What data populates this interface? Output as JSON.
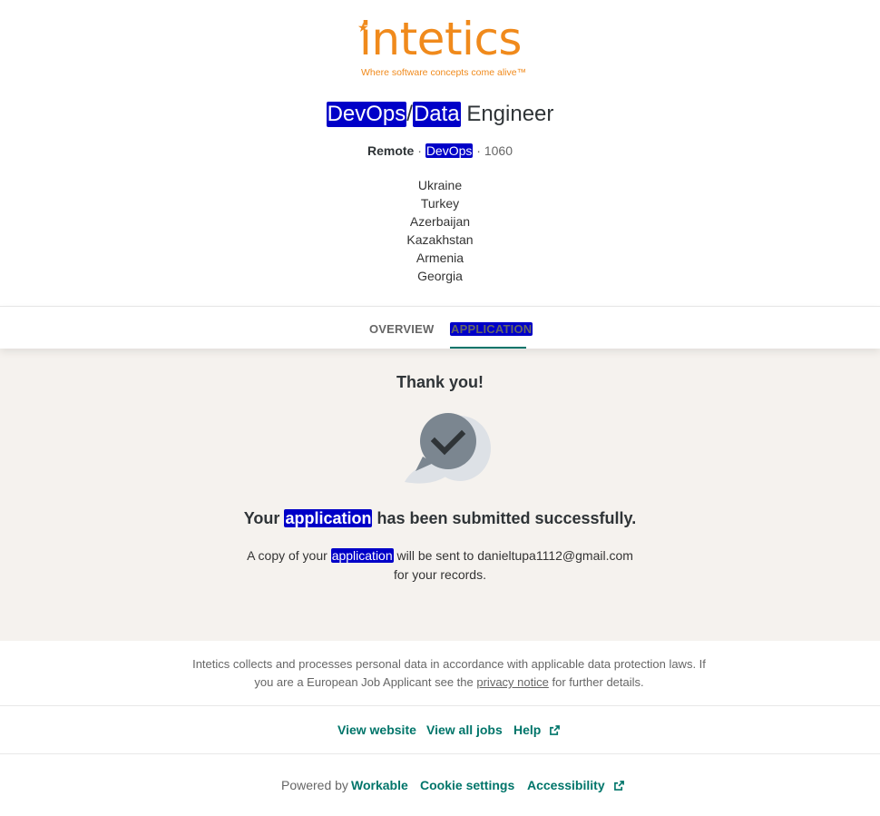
{
  "brand": {
    "logo_text": "intetics",
    "tagline": "Where software concepts come alive™",
    "color": "#f08a1c"
  },
  "job": {
    "title_parts": [
      "DevOps",
      "/",
      "Data",
      " Engineer"
    ],
    "workplace": "Remote",
    "department": "DevOps",
    "code": "1060",
    "separator": "·",
    "locations": [
      "Ukraine",
      "Turkey",
      "Azerbaijan",
      "Kazakhstan",
      "Armenia",
      "Georgia"
    ]
  },
  "tabs": [
    {
      "label": "OVERVIEW",
      "active": false
    },
    {
      "label": "APPLICATION",
      "active": true
    }
  ],
  "confirmation": {
    "heading": "Thank you!",
    "icon": "check-bubble-icon",
    "message_parts": [
      "Your ",
      "application",
      " has been submitted successfully."
    ],
    "copy_parts": [
      "A copy of your ",
      "application",
      " will be sent to danieltupa1112@gmail.com"
    ],
    "copy_line2": "for your records."
  },
  "privacy": {
    "text_before": "Intetics collects and processes personal data in accordance with applicable data protection laws. If you are a European Job Applicant see the ",
    "link": "privacy notice",
    "text_after": " for further details."
  },
  "footer_links": {
    "view_website": "View website",
    "view_all_jobs": "View all jobs",
    "help": "Help"
  },
  "powered": {
    "label": "Powered by",
    "workable": "Workable",
    "cookie_settings": "Cookie settings",
    "accessibility": "Accessibility"
  },
  "colors": {
    "accent": "#00756a",
    "panel_bg": "#f5f2ee",
    "highlight": "#0000c8"
  }
}
